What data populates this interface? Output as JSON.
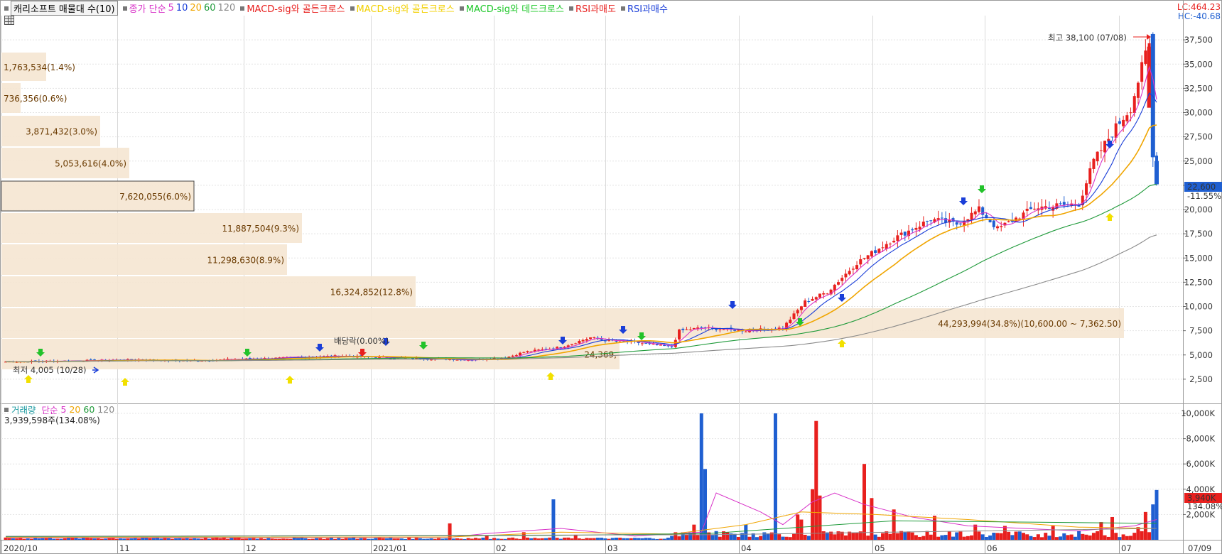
{
  "chart_data": [
    {
      "type": "candlestick",
      "legend": {
        "main_label": "캐리소프트 매물대 수(10)",
        "ma_label": "종가 단순",
        "ma_periods": [
          "5",
          "10",
          "20",
          "60",
          "120"
        ],
        "signals": [
          "MACD-sig와 골든크로스",
          "MACD-sig와 골든크로스",
          "MACD-sig와 데드크로스",
          "RSI과매도",
          "RSI과매수"
        ]
      },
      "corner_labels": {
        "lc": "LC:464.23",
        "hc": "HC:-40.68"
      },
      "y_ticks": [
        "37,500",
        "35,000",
        "32,500",
        "30,000",
        "27,500",
        "25,000",
        "22,500",
        "20,000",
        "17,500",
        "15,000",
        "12,500",
        "10,000",
        "7,500",
        "5,000",
        "2,500"
      ],
      "ylim": [
        0,
        40000
      ],
      "current_price": {
        "value": "22,600",
        "change": "-11.55%"
      },
      "high_annotation": "최고 38,100 (07/08)",
      "low_annotation": "최저 4,005 (10/28)",
      "dividend_label": "배당락(0.00%)",
      "volume_profile": [
        {
          "label": "1,763,534(1.4%)"
        },
        {
          "label": "736,356(0.6%)"
        },
        {
          "label": "3,871,432(3.0%)"
        },
        {
          "label": "5,053,616(4.0%)"
        },
        {
          "label": "7,620,055(6.0%)"
        },
        {
          "label": "11,887,504(9.3%)"
        },
        {
          "label": "11,298,630(8.9%)"
        },
        {
          "label": "16,324,852(12.8%)"
        },
        {
          "label": "44,293,994(34.8%)(10,600.00 ~ 7,362.50)"
        },
        {
          "label": "24,369,"
        }
      ],
      "x_labels": [
        "2020/10",
        "11",
        "12",
        "2021/01",
        "02",
        "03",
        "04",
        "05",
        "06",
        "07"
      ],
      "x_end_label": "07/09"
    },
    {
      "type": "bar",
      "legend": {
        "label": "거래량",
        "ma_label": "단순",
        "ma_periods": [
          "5",
          "20",
          "60",
          "120"
        ]
      },
      "current_value_text": "3,939,598주(134.08%)",
      "y_ticks": [
        "10,000K",
        "8,000K",
        "6,000K",
        "4,000K",
        "2,000K"
      ],
      "ylim": [
        0,
        10000
      ],
      "current_value": {
        "value": "3,940K",
        "change": "134.08%"
      }
    }
  ],
  "colors": {
    "up": "#e8201e",
    "down": "#1f5fd1",
    "ma5": "#d832c8",
    "ma10": "#1a3ed8",
    "ma20": "#f0a500",
    "ma60": "#1f9a3a",
    "ma120": "#8a8a8a",
    "profile": "#f5e6d2"
  }
}
